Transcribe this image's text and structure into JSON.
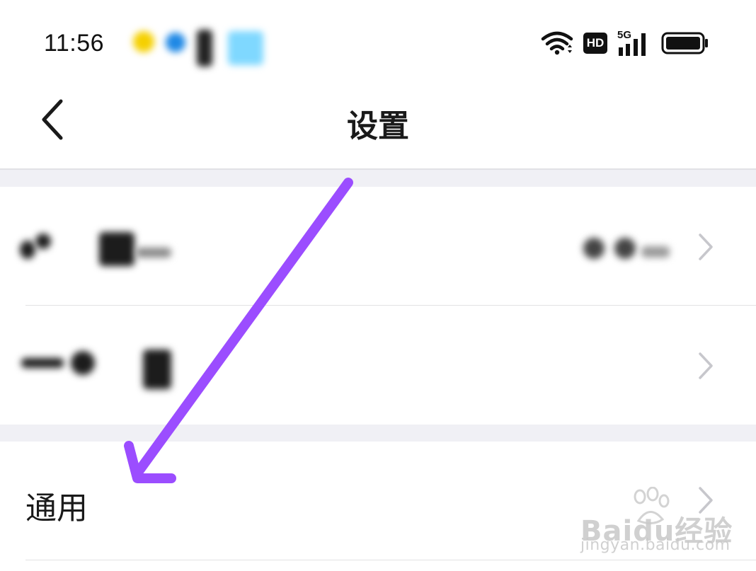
{
  "status_bar": {
    "time": "11:56",
    "icons": [
      "wifi-icon",
      "hd-badge-icon",
      "signal-5g-icon",
      "battery-icon"
    ],
    "hd_label": "HD",
    "network_label": "5G"
  },
  "nav": {
    "title": "设置",
    "back_icon": "chevron-left-icon"
  },
  "settings_rows": [
    {
      "label": "",
      "value": "",
      "obscured": true
    },
    {
      "label": "",
      "obscured": true
    },
    {
      "label": "通用",
      "obscured": false
    }
  ],
  "annotation": {
    "type": "arrow",
    "color": "#9b4dff",
    "points_to": "通用"
  },
  "watermark": {
    "brand": "Baidu经验",
    "url": "jingyan.baidu.com"
  },
  "colors": {
    "background": "#ffffff",
    "group_gap": "#f0f0f5",
    "chevron": "#c7c7cc",
    "text": "#1a1a1a"
  }
}
